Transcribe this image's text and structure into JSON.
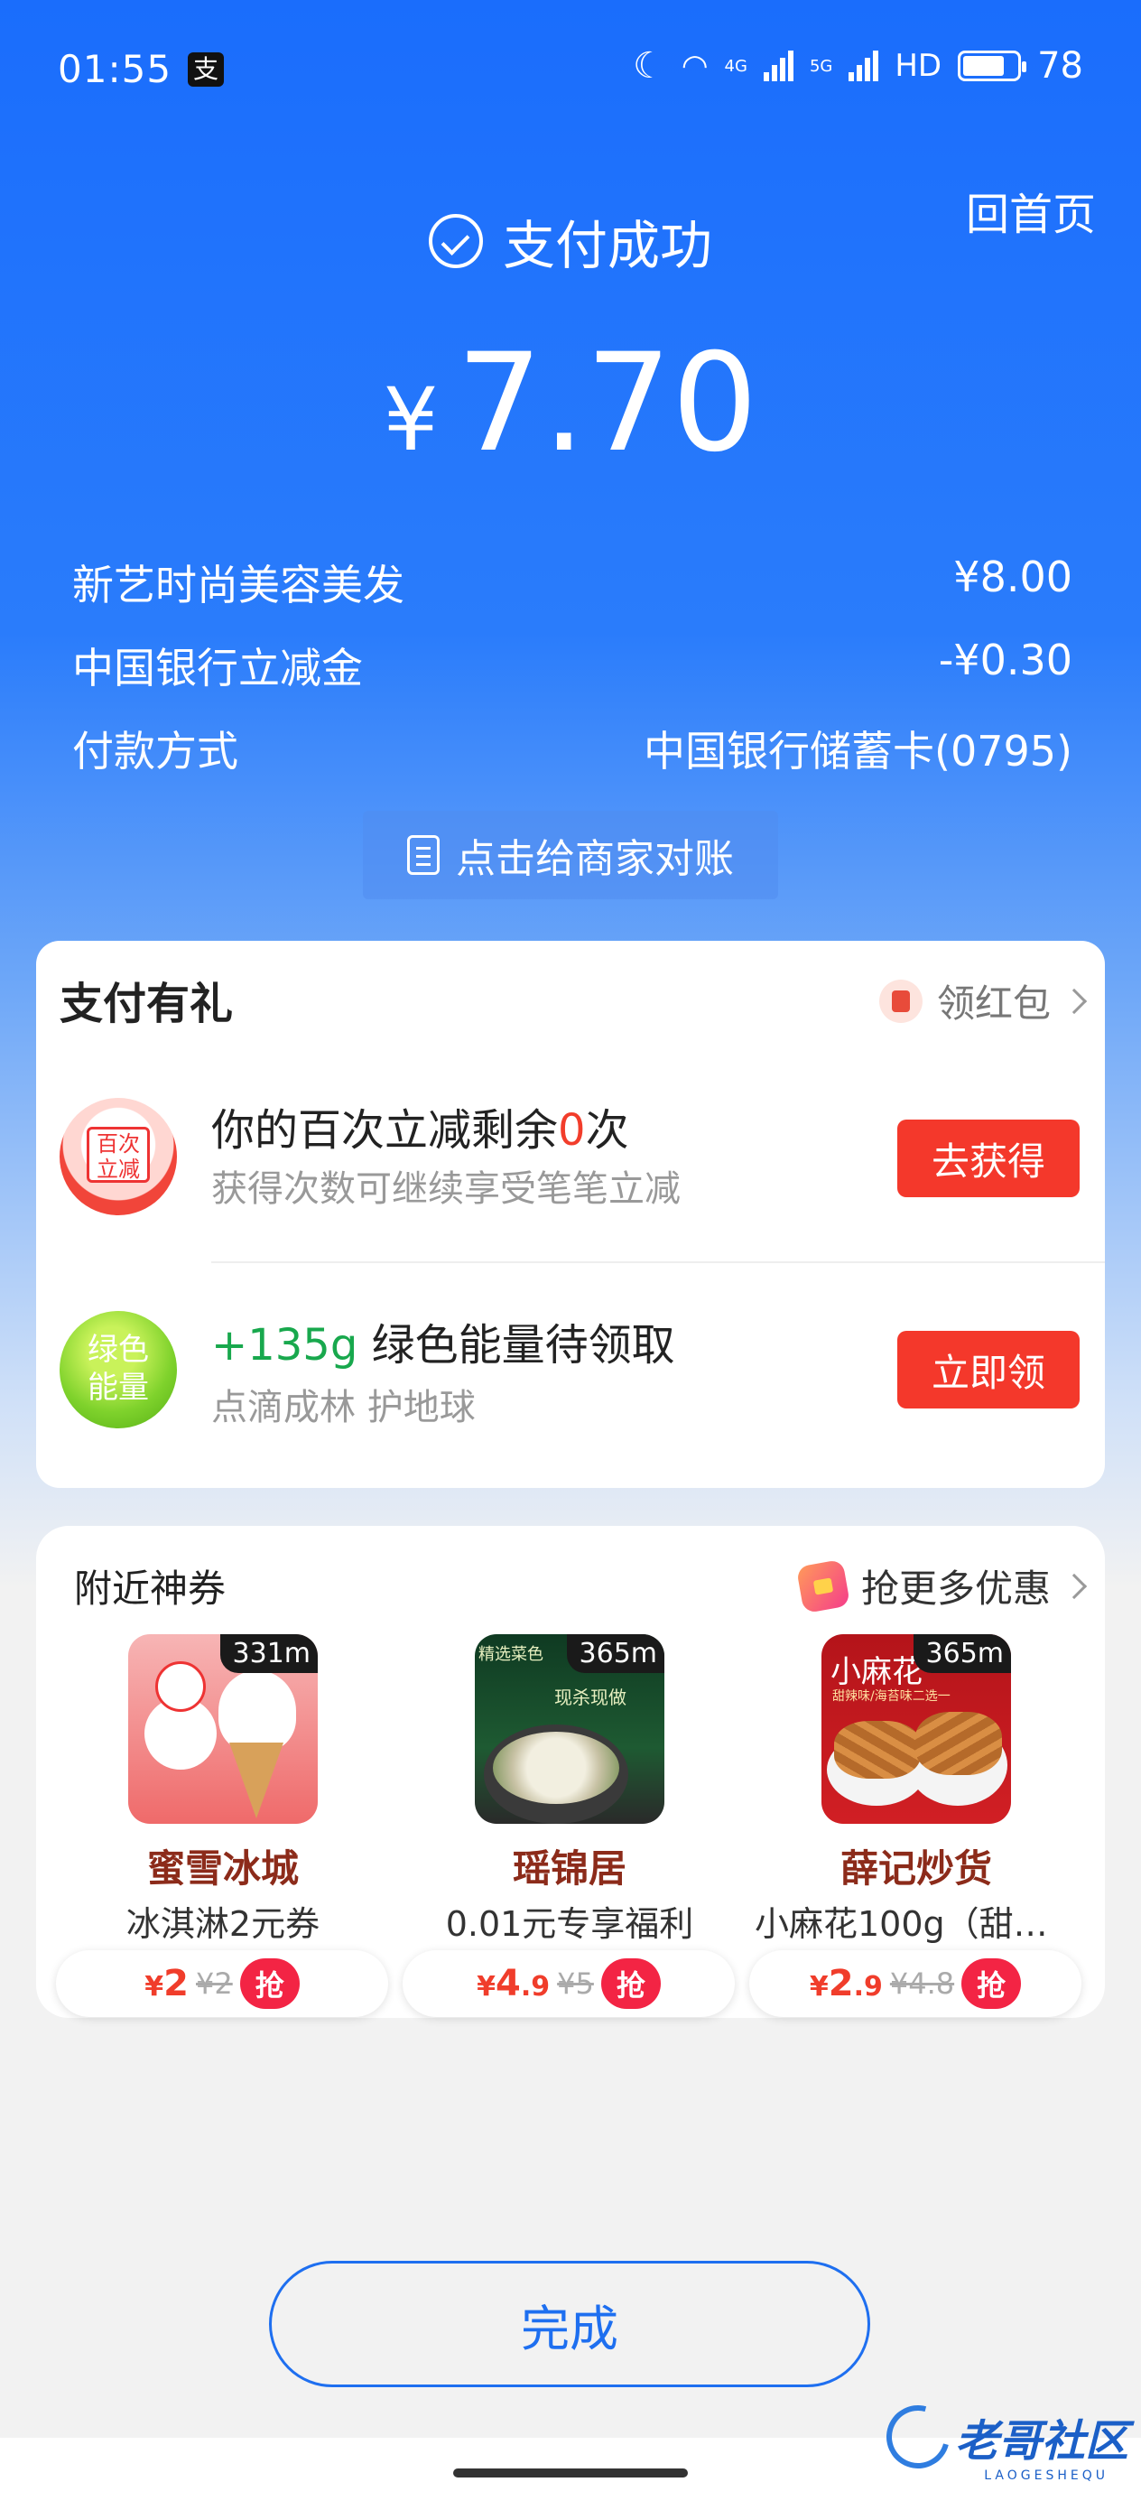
{
  "status_bar": {
    "time": "01:55",
    "app_icon": "支",
    "network_1": "4G",
    "network_2": "5G",
    "hd": "HD",
    "battery": "78"
  },
  "header": {
    "home_link": "回首页",
    "success_text": "支付成功",
    "currency": "¥",
    "amount": "7.70"
  },
  "details": [
    {
      "label": "新艺时尚美容美发",
      "value": "¥8.00"
    },
    {
      "label": "中国银行立减金",
      "value": "-¥0.30"
    },
    {
      "label": "付款方式",
      "value": "中国银行储蓄卡(0795)"
    }
  ],
  "reconcile_button": "点击给商家对账",
  "perks_card": {
    "title": "支付有礼",
    "right_link": "领红包",
    "items": [
      {
        "icon_text_1": "百次",
        "icon_text_2": "立减",
        "title_pre": "你的百次立减剩余",
        "title_num": "0",
        "title_post": "次",
        "subtitle": "获得次数可继续享受笔笔立减",
        "button": "去获得"
      },
      {
        "icon_text_1": "绿色",
        "icon_text_2": "能量",
        "title_num": "+135g",
        "title_post": " 绿色能量待领取",
        "subtitle": "点滴成林 护地球",
        "button": "立即领"
      }
    ]
  },
  "coupons_card": {
    "title": "附近神券",
    "right_link": "抢更多优惠",
    "items": [
      {
        "distance": "331m",
        "name": "蜜雪冰城",
        "desc": "冰淇淋2元券",
        "price_sym": "¥",
        "price_int": "2",
        "price_dec": "",
        "old_price": "¥2",
        "grab": "抢"
      },
      {
        "distance": "365m",
        "name": "瑶锦居",
        "desc": "0.01元专享福利",
        "price_sym": "¥",
        "price_int": "4",
        "price_dec": ".9",
        "old_price": "¥5",
        "grab": "抢",
        "img_text_1": "精选菜色",
        "img_text_2": "现杀现做"
      },
      {
        "distance": "365m",
        "name": "薛记炒货",
        "desc": "小麻花100g（甜辣…",
        "price_sym": "¥",
        "price_int": "2",
        "price_dec": ".9",
        "old_price": "¥4.8",
        "grab": "抢",
        "img_text_1": "小麻花",
        "img_text_2": "甜辣味/海苔味二选一"
      }
    ]
  },
  "done_button": "完成",
  "watermark": {
    "text": "老哥社区",
    "sub": "LAOGESHEQU"
  },
  "colors": {
    "primary_blue": "#1a6dfc",
    "accent_red": "#f4382b",
    "green": "#18a84d"
  }
}
